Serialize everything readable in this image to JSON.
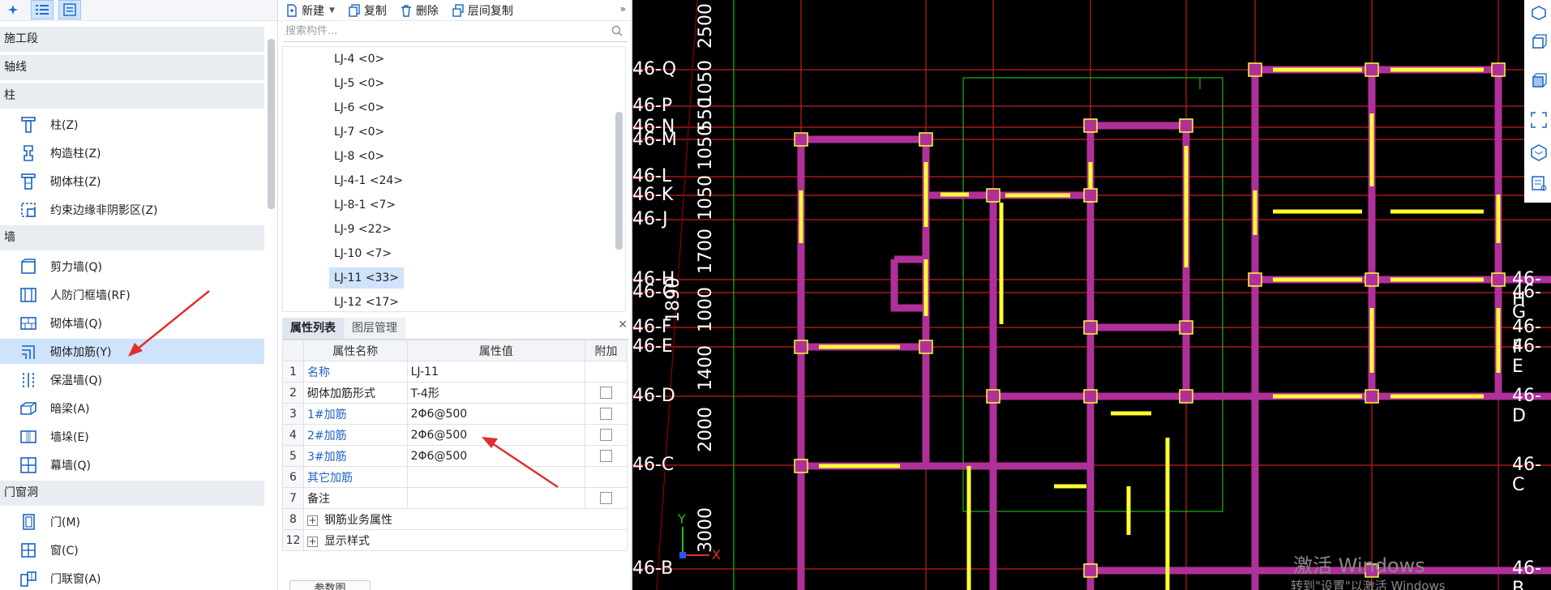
{
  "left_panel": {
    "categories": {
      "construction_stage": "施工段",
      "axis": "轴线",
      "column": "柱",
      "wall": "墙",
      "door_window": "门窗洞"
    },
    "items": {
      "column": "柱(Z)",
      "structural_column": "构造柱(Z)",
      "masonry_column": "砌体柱(Z)",
      "constraint_edge": "约束边缘非阴影区(Z)",
      "shear_wall": "剪力墙(Q)",
      "civil_defense_frame_wall": "人防门框墙(RF)",
      "masonry_wall": "砌体墙(Q)",
      "masonry_reinforcement": "砌体加筋(Y)",
      "insulation_wall": "保温墙(Q)",
      "hidden_beam": "暗梁(A)",
      "wall_pier": "墙垛(E)",
      "curtain_wall": "幕墙(Q)",
      "door": "门(M)",
      "window": "窗(C)",
      "door_window_combo": "门联窗(A)"
    }
  },
  "toolbar": {
    "new": "新建",
    "copy": "复制",
    "delete": "删除",
    "floor_copy": "层间复制"
  },
  "search": {
    "placeholder": "搜索构件..."
  },
  "component_list": [
    "LJ-4 <0>",
    "LJ-5 <0>",
    "LJ-6 <0>",
    "LJ-7 <0>",
    "LJ-8 <0>",
    "LJ-4-1 <24>",
    "LJ-8-1 <7>",
    "LJ-9 <22>",
    "LJ-10 <7>",
    "LJ-11 <33>",
    "LJ-12 <17>"
  ],
  "properties": {
    "tab_active": "属性列表",
    "tab_layers": "图层管理",
    "headers": {
      "name": "属性名称",
      "value": "属性值",
      "extra": "附加"
    },
    "rows": [
      {
        "num": "1",
        "name": "名称",
        "value": "LJ-11"
      },
      {
        "num": "2",
        "name": "砌体加筋形式",
        "value": "T-4形"
      },
      {
        "num": "3",
        "name": "1#加筋",
        "value": "2Φ6@500"
      },
      {
        "num": "4",
        "name": "2#加筋",
        "value": "2Φ6@500"
      },
      {
        "num": "5",
        "name": "3#加筋",
        "value": "2Φ6@500"
      },
      {
        "num": "6",
        "name": "其它加筋",
        "value": ""
      },
      {
        "num": "7",
        "name": "备注",
        "value": ""
      },
      {
        "num": "8",
        "name": "钢筋业务属性",
        "value": ""
      },
      {
        "num": "12",
        "name": "显示样式",
        "value": ""
      }
    ],
    "param_button": "参数图"
  },
  "cad": {
    "axis_rows": [
      "46-Q",
      "46-P",
      "46-N",
      "46-M",
      "46-L",
      "46-K",
      "46-J",
      "46-H",
      "46-G",
      "46-F",
      "46-E",
      "46-D",
      "46-C",
      "46-B"
    ],
    "right_axis_rows": [
      "46-H",
      "46-G",
      "46-F",
      "46-E",
      "46-D",
      "46-C",
      "46-B"
    ],
    "dims": [
      "2500",
      "1050",
      "550",
      "1050",
      "1050",
      "1700",
      "1000",
      "1400",
      "2000",
      "3000",
      "1890"
    ],
    "watermark_line1": "激活 Windows",
    "watermark_line2": "转到\"设置\"以激活 Windows",
    "colors": {
      "background": "#000000",
      "wall": "#b0309a",
      "reinforcement": "#ffff33",
      "grid": "#d00000",
      "dimension": "#00c800"
    }
  }
}
